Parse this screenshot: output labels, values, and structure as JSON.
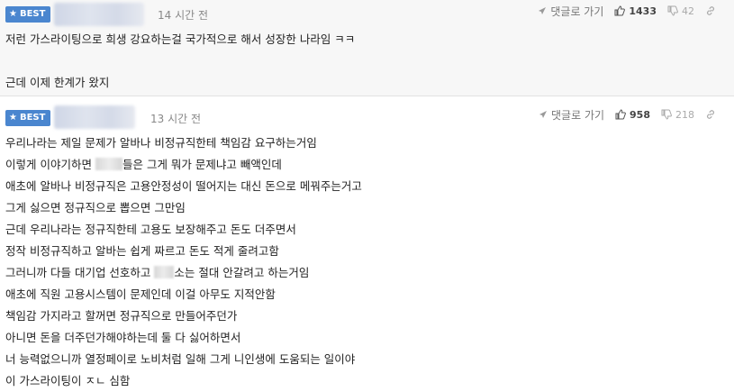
{
  "comments": [
    {
      "badge": "BEST",
      "time": "14 시간 전",
      "reply_label": "댓글로 가기",
      "up": "1433",
      "down": "42",
      "lines": [
        "저런 가스라이팅으로 희생 강요하는걸 국가적으로 해서 성장한 나라임 ㅋㅋ",
        "",
        "근데 이제 한계가 왔지"
      ]
    },
    {
      "badge": "BEST",
      "time": "13 시간 전",
      "reply_label": "댓글로 가기",
      "up": "958",
      "down": "218",
      "lines": [
        "우리나라는 제일 문제가 알바나 비정규직한테 책임감 요구하는거임",
        "이렇게 이야기하면",
        "들은 그게 뭐가 문제냐고 빼액인데",
        "애초에 알바나 비정규직은 고용안정성이 떨어지는 대신 돈으로 메꿔주는거고",
        "그게 싫으면 정규직으로 뽑으면 그만임",
        "근데 우리나라는 정규직한테 고용도 보장해주고 돈도 더주면서",
        "정작 비정규직하고 알바는 쉽게 짜르고 돈도 적게 줄려고함",
        "그러니까 다들 대기업 선호하고",
        "소는 절대 안갈려고 하는거임",
        "애초에 직원 고용시스템이 문제인데 이걸 아무도 지적안함",
        "책임감 가지라고 할꺼면 정규직으로 만들어주던가",
        "아니면 돈을 더주던가해야하는데 둘 다 싫어하면서",
        "너 능력없으니까 열정페이로 노비처럼 일해 그게 니인생에 도움되는 일이야",
        "이 가스라이팅이 ㅈㄴ 심함"
      ]
    }
  ],
  "colors": {
    "badge_bg": "#4a86cf",
    "first_bg": "#f7f7f7"
  },
  "icons": [
    "star-icon",
    "reply-arrow-icon",
    "thumbs-up-icon",
    "thumbs-down-icon",
    "link-icon"
  ]
}
